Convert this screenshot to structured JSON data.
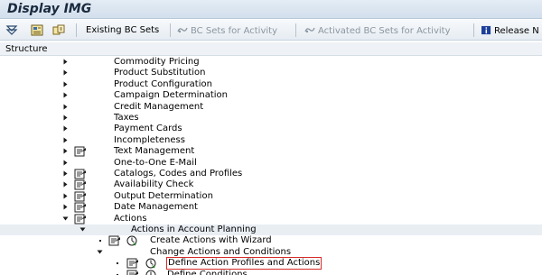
{
  "window": {
    "title": "Display IMG"
  },
  "toolbar": {
    "existing_bc_sets": "Existing BC Sets",
    "bc_sets_for_activity": "BC Sets for Activity",
    "activated_bc_sets_for_activity": "Activated BC Sets for Activity",
    "release_notes": "Release N"
  },
  "structure": {
    "header": "Structure"
  },
  "tree": [
    {
      "label": "Commodity Pricing",
      "state": "collapsed",
      "doc_icon": false
    },
    {
      "label": "Product Substitution",
      "state": "collapsed",
      "doc_icon": false
    },
    {
      "label": "Product Configuration",
      "state": "collapsed",
      "doc_icon": false
    },
    {
      "label": "Campaign Determination",
      "state": "collapsed",
      "doc_icon": false
    },
    {
      "label": "Credit Management",
      "state": "collapsed",
      "doc_icon": false
    },
    {
      "label": "Taxes",
      "state": "collapsed",
      "doc_icon": false
    },
    {
      "label": "Payment Cards",
      "state": "collapsed",
      "doc_icon": false
    },
    {
      "label": "Incompleteness",
      "state": "collapsed",
      "doc_icon": false
    },
    {
      "label": "Text Management",
      "state": "collapsed",
      "doc_icon": true
    },
    {
      "label": "One-to-One E-Mail",
      "state": "collapsed",
      "doc_icon": false
    },
    {
      "label": "Catalogs, Codes and Profiles",
      "state": "collapsed",
      "doc_icon": true
    },
    {
      "label": "Availability Check",
      "state": "collapsed",
      "doc_icon": true
    },
    {
      "label": "Output Determination",
      "state": "collapsed",
      "doc_icon": true
    },
    {
      "label": "Date Management",
      "state": "collapsed",
      "doc_icon": true
    },
    {
      "label": "Actions",
      "state": "expanded",
      "doc_icon": true
    },
    {
      "label": "Actions in Account Planning",
      "state": "expanded",
      "doc_icon": false
    },
    {
      "label": "Create Actions with Wizard",
      "state": "leaf",
      "doc_icon": true,
      "clock_icon": true
    },
    {
      "label": "Change Actions and Conditions",
      "state": "expanded",
      "doc_icon": false
    },
    {
      "label": "Define Action Profiles and Actions",
      "state": "leaf",
      "doc_icon": true,
      "clock_icon": true,
      "highlighted": true
    },
    {
      "label": "Define Conditions",
      "state": "leaf",
      "doc_icon": true,
      "clock_icon": true
    }
  ],
  "colors": {
    "highlight_box": "#d62a2a",
    "title_bar": "#d2dfec",
    "disabled_text": "#8b96a1"
  }
}
